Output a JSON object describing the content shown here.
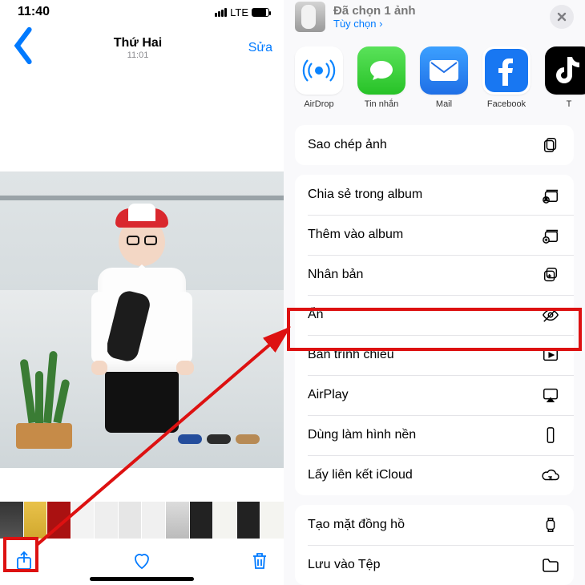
{
  "left": {
    "status_time": "11:40",
    "network_label": "LTE",
    "nav": {
      "title": "Thứ Hai",
      "subtitle": "11:01",
      "edit": "Sửa"
    }
  },
  "sheet": {
    "header": {
      "title": "Đã chọn 1 ảnh",
      "subtitle": "Tùy chọn ›"
    },
    "apps": {
      "airdrop": "AirDrop",
      "messages": "Tin nhắn",
      "mail": "Mail",
      "facebook": "Facebook"
    },
    "actions": {
      "copy": "Sao chép ảnh",
      "share_album": "Chia sẻ trong album",
      "add_album": "Thêm vào album",
      "duplicate": "Nhân bản",
      "hide": "Ẩn",
      "slideshow": "Bản trình chiếu",
      "airplay": "AirPlay",
      "wallpaper": "Dùng làm hình nền",
      "icloud_link": "Lấy liên kết iCloud",
      "watchface": "Tạo mặt đồng hồ",
      "save_files": "Lưu vào Tệp"
    }
  }
}
